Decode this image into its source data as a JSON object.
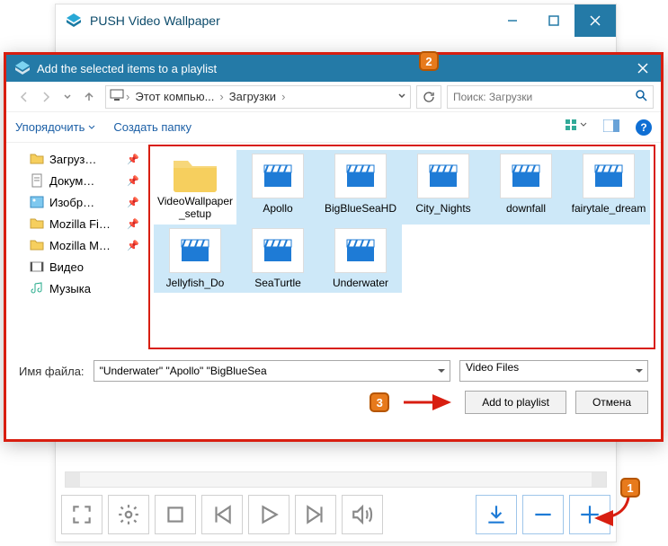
{
  "app": {
    "title": "PUSH Video Wallpaper"
  },
  "dialog": {
    "title": "Add the selected items to a playlist",
    "breadcrumb": {
      "seg1": "Этот компью...",
      "seg2": "Загрузки"
    },
    "search_placeholder": "Поиск: Загрузки",
    "organize": "Упорядочить",
    "new_folder": "Создать папку",
    "sidebar": {
      "downloads": "Загруз…",
      "documents": "Докум…",
      "pictures": "Изобр…",
      "mozilla_fi": "Mozilla Fi…",
      "mozilla_m": "Mozilla M…",
      "videos": "Видео",
      "music": "Музыка"
    },
    "files": {
      "folder": "VideoWallpaper_setup",
      "apollo": "Apollo",
      "bigblue": "BigBlueSeaHD",
      "city": "City_Nights",
      "downfall": "downfall",
      "fairy": "fairytale_dream",
      "jelly": "Jellyfish_Do",
      "turtle": "SeaTurtle",
      "under": "Underwater"
    },
    "filename_label": "Имя файла:",
    "filename_value": "\"Underwater\" \"Apollo\" \"BigBlueSea",
    "filter_label": "Video Files",
    "add_btn": "Add to playlist",
    "cancel_btn": "Отмена"
  },
  "callouts": {
    "c1": "1",
    "c2": "2",
    "c3": "3"
  }
}
